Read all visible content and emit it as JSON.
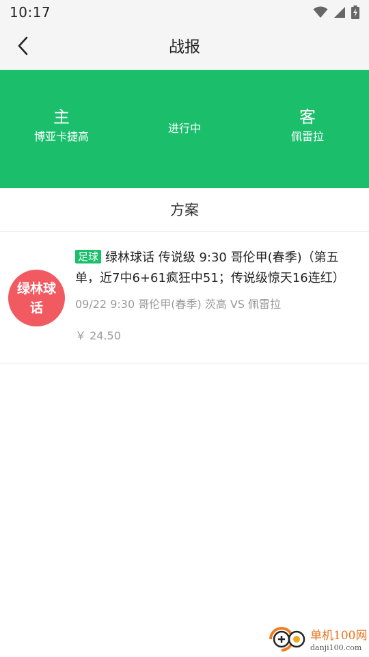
{
  "status_bar": {
    "time": "10:17",
    "icons": [
      "wifi-icon",
      "signal-icon",
      "battery-charging-icon"
    ]
  },
  "header": {
    "back_icon": "chevron-left-icon",
    "title": "战报"
  },
  "match": {
    "home": {
      "role": "主",
      "name": "博亚卡捷高"
    },
    "status": "进行中",
    "away": {
      "role": "客",
      "name": "佩雷拉"
    },
    "banner_color": "#1bbf6b"
  },
  "section": {
    "title": "方案"
  },
  "plan": {
    "author_avatar_text": "绿林球话",
    "avatar_color": "#f25a62",
    "sport_tag": "足球",
    "title": "绿林球话 传说级 9:30 哥伦甲(春季)（第五单，近7中6+61疯狂中51；传说级惊天16连红）",
    "meta": "09/22 9:30 哥伦甲(春季) 茨高 VS 佩雷拉",
    "price": "￥ 24.50"
  },
  "watermark": {
    "brand": "单机100网",
    "url": "danji100.com"
  }
}
